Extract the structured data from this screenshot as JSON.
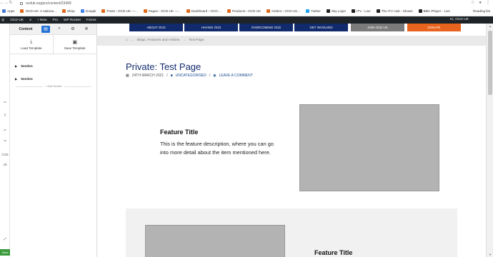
{
  "browser": {
    "url": "ocduk.org/pro/content/23499",
    "reading_list": "Reading list",
    "bookmarks": [
      {
        "label": "Apps",
        "color": "#4a7bd4"
      },
      {
        "label": "OCD-UK: A nationa...",
        "color": "#e06a1b"
      },
      {
        "label": "Shop",
        "color": "#e06a1b"
      },
      {
        "label": "Google",
        "color": "#4285f4"
      },
      {
        "label": "Posts ‹ OCD-UK —...",
        "color": "#e06a1b"
      },
      {
        "label": "Pages ‹ OCD-UK —...",
        "color": "#e06a1b"
      },
      {
        "label": "Dashboard ‹ OCD-...",
        "color": "#e06a1b"
      },
      {
        "label": "Products ‹ OCD-UK",
        "color": "#e06a1b"
      },
      {
        "label": "Orders ‹ OCD-UK...",
        "color": "#e06a1b"
      },
      {
        "label": "Twitter",
        "color": "#1da1f2"
      },
      {
        "label": "Sky Login",
        "color": "#222222"
      },
      {
        "label": "ITV - Live",
        "color": "#222222"
      },
      {
        "label": "The ITV Hub - Shows",
        "color": "#222222"
      },
      {
        "label": "BBC iPlayer - Live",
        "color": "#222222"
      }
    ]
  },
  "wpbar": {
    "items": [
      "OCD-UK",
      "4",
      "+ New",
      "Pro",
      "WP Rocket",
      "Forms"
    ],
    "howdy": "Hi, OCD-UK"
  },
  "toolstrip": {
    "css": "CSS",
    "js": "JS",
    "save": "Save"
  },
  "builder": {
    "content_tab": "Content",
    "load_template": "Load Template",
    "save_template": "Save Template",
    "sections": [
      "Section",
      "Section"
    ],
    "add_section": "+ Add Section"
  },
  "site": {
    "nav": [
      {
        "label": "ABOUT OCD",
        "color": "#102a6b"
      },
      {
        "label": "HAVING OCD",
        "color": "#102a6b"
      },
      {
        "label": "OVERCOMING OCD",
        "color": "#102a6b"
      },
      {
        "label": "GET INVOLVED",
        "color": "#102a6b"
      },
      {
        "label": "JOIN OCD-UK",
        "color": "#7b7b7b"
      },
      {
        "label": "DONATE",
        "color": "#e8641e"
      }
    ],
    "breadcrumb": {
      "home_icon": "home-icon",
      "sep": "→",
      "parent": "Blogs, Features and Articles",
      "current": "Test Page"
    },
    "page_title": "Private: Test Page",
    "meta": {
      "date": "24TH MARCH 2021",
      "category": "UNCATEGORISED",
      "comment": "LEAVE A COMMENT"
    },
    "feature1": {
      "title": "Feature Title",
      "description": "This is the feature description, where you can go into more detail about the item mentioned here."
    },
    "feature2": {
      "title": "Feature Title"
    }
  }
}
